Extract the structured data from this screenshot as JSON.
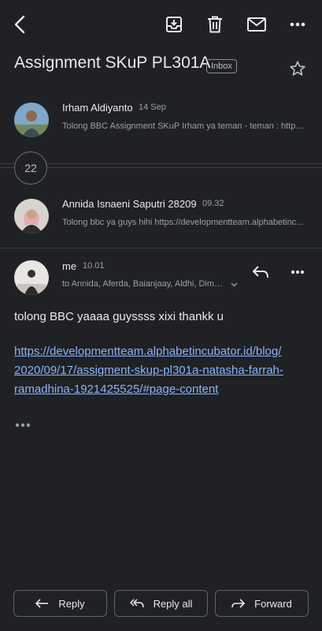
{
  "toolbar": {
    "back_icon": "arrow-back-icon",
    "archive_icon": "archive-icon",
    "delete_icon": "trash-icon",
    "mark_unread_icon": "mail-icon",
    "more_icon": "more-horizontal-icon"
  },
  "thread": {
    "subject": "Assignment SKuP PL301A",
    "label": "Inbox",
    "collapsed_count": "22"
  },
  "messages": [
    {
      "sender": "Irham Aldiyanto",
      "time": "14 Sep",
      "snippet": "Tolong BBC Assignment SKuP Irham ya teman - teman : https:..."
    },
    {
      "sender": "Annida Isnaeni Saputri 28209",
      "time": "09.32",
      "snippet": "Tolong bbc ya guys hihi https://developmentteam.alphabetinc..."
    }
  ],
  "open_message": {
    "sender": "me",
    "time": "10.01",
    "recipients": "to Annida, Aferda, Baianjaay, Aldhi, Dimas...",
    "body": "tolong BBC yaaaa guyssss xixi thankk u",
    "link_lines": [
      "https://developmentteam.alphabetincubator.id/blog/",
      "2020/09/17/assigment-skup-pl301a-natasha-farrah-",
      "ramadhina-1921425525/#page-content"
    ]
  },
  "actions": {
    "reply": "Reply",
    "reply_all": "Reply all",
    "forward": "Forward"
  },
  "colors": {
    "background": "#202124",
    "text": "#e8eaed",
    "secondary_text": "#9aa0a6",
    "link": "#8ab4f8",
    "divider": "#3c4043"
  }
}
